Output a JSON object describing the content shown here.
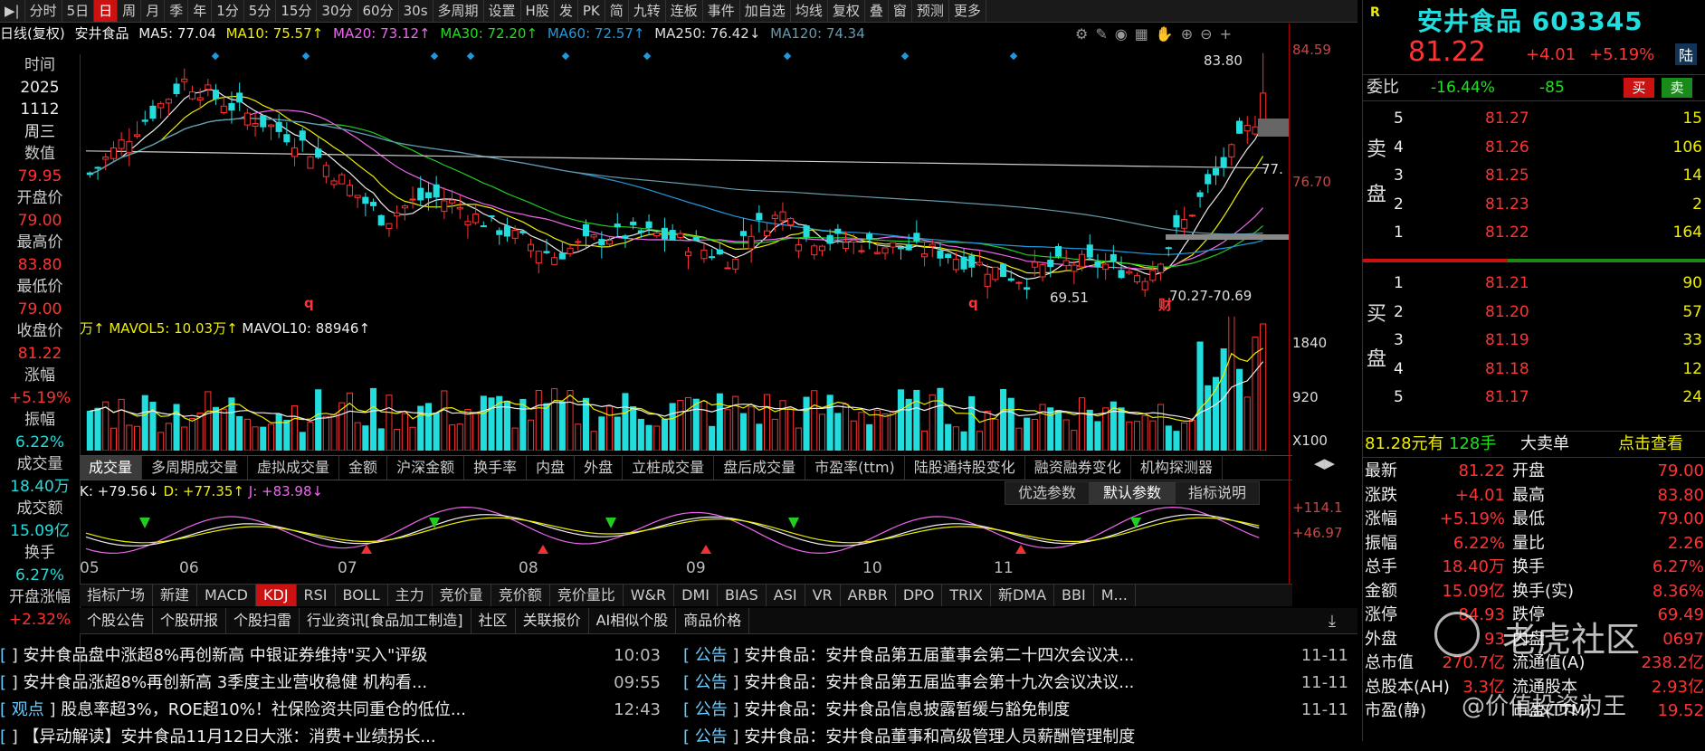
{
  "toolbar": {
    "items": [
      "分时",
      "5日",
      "日",
      "周",
      "月",
      "季",
      "年",
      "1分",
      "5分",
      "15分",
      "30分",
      "60分",
      "30s",
      "多周期",
      "设置",
      "H股",
      "发",
      "PK",
      "简",
      "九转",
      "连板",
      "事件",
      "加自选",
      "均线",
      "复权",
      "叠",
      "窗",
      "预测",
      "更多"
    ],
    "active_index": 2
  },
  "main_legend": {
    "period": "日线(复权)",
    "name": "安井食品",
    "ma5": "MA5: 77.04",
    "ma10": "MA10: 75.57↑",
    "ma20": "MA20: 73.12↑",
    "ma30": "MA30: 72.20↑",
    "ma60": "MA60: 72.57↑",
    "ma250": "MA250: 76.42↓",
    "ma120": "MA120: 74.34"
  },
  "colors": {
    "up": "#ff3333",
    "down": "#22dddd",
    "ma5": "#eeeeee",
    "ma10": "#eeee00",
    "ma20": "#ee66ee",
    "ma30": "#22cc22",
    "ma60": "#2299dd",
    "ma250": "#cccccc",
    "ma120": "#6699aa"
  },
  "axis": {
    "main_ticks": [
      "84.59",
      "76.70"
    ],
    "vol_ticks": [
      "1840",
      "920",
      "X100"
    ],
    "kdj_ticks": [
      "+114.1",
      "+46.97"
    ]
  },
  "annotations": {
    "high": "83.80",
    "low1": "69.51",
    "range": "70.27-70.69",
    "cur": "77.",
    "q1": "q",
    "q2": "q",
    "cai": "财"
  },
  "info_panel": [
    {
      "label": "时间",
      "value": "2025"
    },
    {
      "label": "",
      "value": "1112"
    },
    {
      "label": "",
      "value": "周三"
    },
    {
      "label": "数值",
      "value": "79.95"
    },
    {
      "label": "开盘价",
      "value": "79.00"
    },
    {
      "label": "最高价",
      "value": "83.80"
    },
    {
      "label": "最低价",
      "value": "79.00"
    },
    {
      "label": "收盘价",
      "value": "81.22"
    },
    {
      "label": "涨幅",
      "value": "+5.19%"
    },
    {
      "label": "振幅",
      "value": "6.22%"
    },
    {
      "label": "成交量",
      "value": "18.40万"
    },
    {
      "label": "成交额",
      "value": "15.09亿"
    },
    {
      "label": "换手",
      "value": "6.27%"
    },
    {
      "label": "开盘涨幅",
      "value": "+2.32%"
    }
  ],
  "vol_legend": {
    "vol": "万↑",
    "mavol5": "MAVOL5: 10.03万↑",
    "mavol10": "MAVOL10: 88946↑"
  },
  "vol_tabs": [
    "成交量",
    "多周期成交量",
    "虚拟成交量",
    "金额",
    "沪深金额",
    "换手率",
    "内盘",
    "外盘",
    "立桩成交量",
    "盘后成交量",
    "市盈率(ttm)",
    "陆股通持股变化",
    "融资融券变化",
    "机构探测器"
  ],
  "kdj_legend": {
    "k": "K: +79.56↓",
    "d": "D: +77.35↑",
    "j": "J: +83.98↓"
  },
  "kdj_buttons": [
    "优选参数",
    "默认参数",
    "指标说明"
  ],
  "months": [
    "05",
    "06",
    "07",
    "08",
    "09",
    "10",
    "11"
  ],
  "indicator_tabs": [
    "指标广场",
    "新建",
    "MACD",
    "KDJ",
    "RSI",
    "BOLL",
    "主力",
    "竞价量",
    "竞价额",
    "竞价量比",
    "W&R",
    "DMI",
    "BIAS",
    "ASI",
    "VR",
    "ARBR",
    "DPO",
    "TRIX",
    "新DMA",
    "BBI",
    "M..."
  ],
  "news_tabs": [
    "个股公告",
    "个股研报",
    "个股扫雷",
    "行业资讯[食品加工制造]",
    "社区",
    "关联报价",
    "AI相似个股",
    "商品价格"
  ],
  "news_left": [
    {
      "tag": "",
      "title": "安井食品盘中涨超8%再创新高 中银证券维持\"买入\"评级",
      "time": "10:03"
    },
    {
      "tag": "",
      "title": "安井食品涨超8%再创新高 3季度主业营收稳健 机构看...",
      "time": "09:55"
    },
    {
      "tag": "观点",
      "title": "股息率超3%，ROE超10%！社保险资共同重仓的低位...",
      "time": "12:43"
    },
    {
      "tag": "",
      "title": "【异动解读】安井食品11月12日大涨：消费+业绩拐长...",
      "time": ""
    }
  ],
  "news_right": [
    {
      "tag": "公告",
      "title": "安井食品：安井食品第五届董事会第二十四次会议决...",
      "time": "11-11"
    },
    {
      "tag": "公告",
      "title": "安井食品：安井食品第五届监事会第十九次会议决议...",
      "time": "11-11"
    },
    {
      "tag": "公告",
      "title": "安井食品：安井食品信息披露暂缓与豁免制度",
      "time": "11-11"
    },
    {
      "tag": "公告",
      "title": "安井食品：安井食品董事和高级管理人员薪酬管理制度",
      "time": ""
    }
  ],
  "quote": {
    "name": "安井食品",
    "code": "603345",
    "price": "81.22",
    "change": "+4.01",
    "change_pct": "+5.19%",
    "tag": "陆",
    "weibi_label": "委比",
    "weibi": "-16.44%",
    "weicha": "-85",
    "buy_btn": "买",
    "sell_btn": "卖",
    "sell_side": "卖盘",
    "buy_side": "买盘",
    "sells": [
      {
        "lvl": "5",
        "price": "81.27",
        "vol": "15"
      },
      {
        "lvl": "4",
        "price": "81.26",
        "vol": "106"
      },
      {
        "lvl": "3",
        "price": "81.25",
        "vol": "14"
      },
      {
        "lvl": "2",
        "price": "81.23",
        "vol": "2"
      },
      {
        "lvl": "1",
        "price": "81.22",
        "vol": "164"
      }
    ],
    "buys": [
      {
        "lvl": "1",
        "price": "81.21",
        "vol": "90"
      },
      {
        "lvl": "2",
        "price": "81.20",
        "vol": "57"
      },
      {
        "lvl": "3",
        "price": "81.19",
        "vol": "33"
      },
      {
        "lvl": "4",
        "price": "81.18",
        "vol": "12"
      },
      {
        "lvl": "5",
        "price": "81.17",
        "vol": "24"
      }
    ],
    "bigorder": {
      "price": "81.28元有",
      "qty": "128手",
      "label": "大卖单",
      "action": "点击查看"
    },
    "stats": [
      [
        "最新",
        "81.22",
        "开盘",
        "79.00"
      ],
      [
        "涨跌",
        "+4.01",
        "最高",
        "83.80"
      ],
      [
        "涨幅",
        "+5.19%",
        "最低",
        "79.00"
      ],
      [
        "振幅",
        "6.22%",
        "量比",
        "2.26"
      ],
      [
        "总手",
        "18.40万",
        "换手",
        "6.27%"
      ],
      [
        "金额",
        "15.09亿",
        "换手(实)",
        "8.36%"
      ],
      [
        "涨停",
        "84.93",
        "跌停",
        "69.49"
      ],
      [
        "外盘",
        "93",
        "内盘",
        "0697"
      ],
      [
        "总市值",
        "270.7亿",
        "流通值(A)",
        "238.2亿"
      ],
      [
        "总股本(AH)",
        "3.3亿",
        "流通股本",
        "2.93亿"
      ],
      [
        "市盈(静)",
        "",
        "市盈(TTM)",
        "19.52"
      ]
    ]
  },
  "watermark": {
    "line1": "老虎社区",
    "line2": "@价值投资为王"
  }
}
